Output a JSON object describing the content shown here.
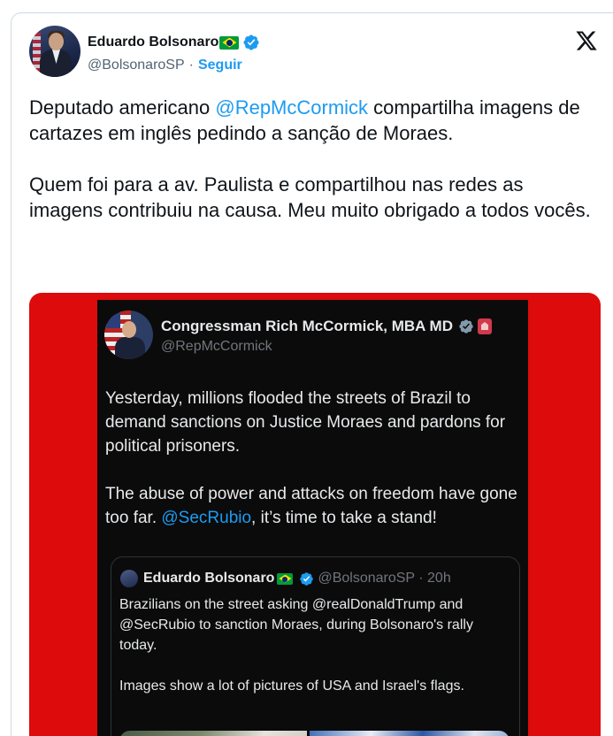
{
  "author": {
    "display_name": "Eduardo Bolsonaro",
    "handle": "@BolsonaroSP",
    "separator": "·",
    "follow_label": "Seguir"
  },
  "tweet": {
    "p1_pre": "Deputado americano ",
    "p1_mention": "@RepMcCormick",
    "p1_post": " compartilha imagens de cartazes em inglês pedindo a sanção de Moraes.",
    "p2": "Quem foi para a av. Paulista e compartilhou nas redes as imagens contribuiu na causa. Meu muito obrigado a todos vocês."
  },
  "embedded": {
    "name": "Congressman Rich McCormick, MBA MD",
    "handle": "@RepMcCormick",
    "p1": "Yesterday, millions flooded the streets of Brazil to demand sanctions on Justice Moraes and pardons for political prisoners.",
    "p2_pre": "The abuse of power and attacks on freedom have gone too far. ",
    "p2_mention": "@SecRubio",
    "p2_post": ", it’s time to take a stand!"
  },
  "quoted": {
    "name": "Eduardo Bolsonaro",
    "handle_time": "@BolsonaroSP · 20h",
    "p1": "Brazilians on the street asking @realDonaldTrump and @SecRubio to sanction Moraes, during Bolsonaro's rally today.",
    "p2": "Images show a lot of pictures of USA and Israel's flags."
  },
  "colors": {
    "link": "#1d9bf0",
    "media_background": "#dd0b0b",
    "verified_blue": "#1d9bf0"
  }
}
